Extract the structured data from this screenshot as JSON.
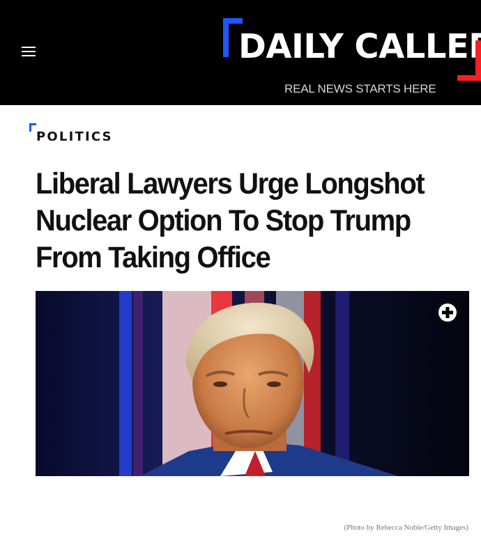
{
  "header": {
    "logo_text": "DAILY CALLER",
    "tagline": "REAL NEWS STARTS HERE",
    "menu_icon": "hamburger-menu-icon",
    "colors": {
      "background": "#000000",
      "logo_accent_blue": "#1e56ff",
      "logo_accent_red": "#ff1f1f"
    }
  },
  "article": {
    "category": "POLITICS",
    "headline": "Liberal Lawyers Urge Longshot Nuclear Option To Stop Trump From Taking Office",
    "image": {
      "expand_icon": "plus-circle-icon",
      "credit": "(Photo by Rebecca Noble/Getty Images)"
    }
  }
}
